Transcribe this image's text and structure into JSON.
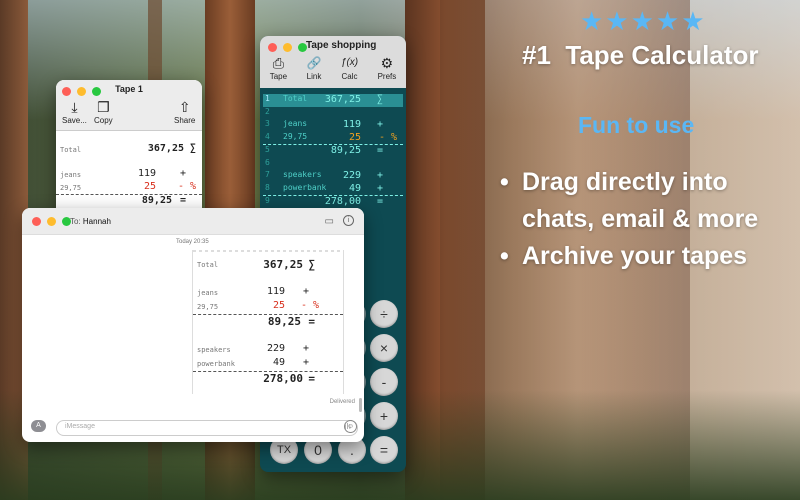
{
  "marketing": {
    "stars": "★★★★★",
    "headline": "#1  Tape Calculator",
    "subhead": "Fun to use",
    "bullets": [
      {
        "dot": "•",
        "line1": "Drag directly into",
        "line2": "chats, email & more"
      },
      {
        "dot": "•",
        "line1": "Archive your tapes"
      }
    ]
  },
  "shop_window": {
    "title": "Tape shopping",
    "toolbar": [
      {
        "label": "Tape",
        "icon": "tape-icon",
        "glyph": "⎙"
      },
      {
        "label": "Link",
        "icon": "link-icon",
        "glyph": "🔗"
      },
      {
        "label": "Calc",
        "icon": "function-icon",
        "glyph": "ƒ(x)"
      },
      {
        "label": "Prefs",
        "icon": "gear-icon",
        "glyph": "⚙"
      }
    ],
    "lines": [
      {
        "n": "1",
        "label": "Total",
        "value": "367,25",
        "op": "∑"
      },
      {
        "n": "2",
        "label": "",
        "value": "",
        "op": ""
      },
      {
        "n": "3",
        "label": "jeans",
        "value": "119",
        "op": "+"
      },
      {
        "n": "4",
        "label": "29,75",
        "value": "25",
        "op": "- %"
      },
      {
        "n": "5",
        "label": "",
        "value": "89,25",
        "op": "="
      },
      {
        "n": "6",
        "label": "",
        "value": "",
        "op": ""
      },
      {
        "n": "7",
        "label": "speakers",
        "value": "229",
        "op": "+"
      },
      {
        "n": "8",
        "label": "powerbank",
        "value": "49",
        "op": "+"
      },
      {
        "n": "9",
        "label": "",
        "value": "278,00",
        "op": "="
      }
    ],
    "keys": [
      {
        "label": "÷",
        "name": "divide-key"
      },
      {
        "label": "×",
        "name": "multiply-key"
      },
      {
        "label": "-",
        "name": "minus-key"
      },
      {
        "label": "+",
        "name": "plus-key"
      },
      {
        "label": "=",
        "name": "equals-key"
      },
      {
        "label": "TX",
        "name": "tx-key"
      },
      {
        "label": "0",
        "name": "zero-key"
      },
      {
        "label": ".",
        "name": "decimal-key"
      }
    ]
  },
  "tape1_window": {
    "title": "Tape 1",
    "toolbar": [
      {
        "label": "Save...",
        "icon": "save-icon",
        "glyph": "⤓"
      },
      {
        "label": "Copy",
        "icon": "copy-icon",
        "glyph": "❐"
      },
      {
        "label": "Share",
        "icon": "share-icon",
        "glyph": "⇧"
      }
    ],
    "rows": [
      {
        "label": "Total",
        "value": "367,25",
        "op": "∑"
      },
      {
        "label": "jeans",
        "value": "119",
        "op": "+"
      },
      {
        "label": "29,75",
        "value": "25",
        "op": "- %"
      },
      {
        "label": "",
        "value": "89,25",
        "op": "="
      }
    ]
  },
  "messages_window": {
    "to_label": "To:",
    "to_name": "Hannah",
    "timestamp": "Today 20:35",
    "delivered": "Delivered",
    "placeholder": "iMessage",
    "receipt": [
      {
        "label": "Total",
        "value": "367,25",
        "op": "∑",
        "style": "bold"
      },
      {
        "label": "jeans",
        "value": "119",
        "op": "+",
        "style": ""
      },
      {
        "label": "29,75",
        "value": "25",
        "op": "- %",
        "style": "red"
      },
      {
        "label": "",
        "value": "89,25",
        "op": "=",
        "style": "bold"
      },
      {
        "label": "speakers",
        "value": "229",
        "op": "+",
        "style": ""
      },
      {
        "label": "powerbank",
        "value": "49",
        "op": "+",
        "style": ""
      },
      {
        "label": "",
        "value": "278,00",
        "op": "=",
        "style": "bold"
      }
    ]
  },
  "colors": {
    "accent_blue": "#5ab7f5",
    "tape_bg": "#0e4a52",
    "tape_text": "#7ff0e6",
    "tape_highlight": "#2a8f94",
    "discount_red": "#d8301e",
    "discount_orange": "#f0a020"
  }
}
